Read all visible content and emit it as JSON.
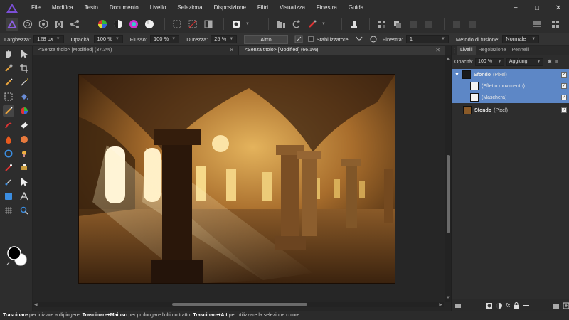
{
  "menubar": {
    "items": [
      "File",
      "Modifica",
      "Testo",
      "Documento",
      "Livello",
      "Seleziona",
      "Disposizione",
      "Filtri",
      "Visualizza",
      "Finestra",
      "Guida"
    ],
    "controls": [
      "−",
      "□",
      "✕"
    ]
  },
  "context": {
    "width_label": "Larghezza:",
    "width_value": "128 px",
    "opacity_label": "Opacità:",
    "opacity_value": "100 %",
    "flow_label": "Flusso:",
    "flow_value": "100 %",
    "hardness_label": "Durezza:",
    "hardness_value": "25 %",
    "more_label": "Altro",
    "stabilizer_label": "Stabilizzatore",
    "window_label": "Finestra:",
    "window_value": "1",
    "blend_label": "Metodo di fusione:",
    "blend_value": "Normale"
  },
  "tabs": [
    {
      "label": "<Senza titolo> [Modified] (37.3%)"
    },
    {
      "label": "<Senza titolo> [Modified] (66.1%)"
    }
  ],
  "panel": {
    "tabs": [
      "Livelli",
      "Regolazione",
      "Pennelli"
    ],
    "opacity_label": "Opacità:",
    "opacity_value": "100 %",
    "blend_value": "Aggiungi",
    "layers": [
      {
        "name": "Sfondo",
        "type": "(Pixel)",
        "selected": true
      },
      {
        "name": "(Effetto movimento)",
        "selected": true
      },
      {
        "name": "(Maschera)",
        "selected": true
      },
      {
        "name": "Sfondo",
        "type": "(Pixel)",
        "selected": false
      }
    ]
  },
  "status": {
    "a_bold": "Trascinare",
    "a_text": " per iniziare a dipingere. ",
    "b_bold": "Trascinare+Maiusc",
    "b_text": " per prolungare l'ultimo tratto. ",
    "c_bold": "Trascinare+Alt",
    "c_text": " per utilizzare la selezione colore."
  },
  "colors": {
    "accent": "#5d87c6",
    "logo": "#7b4fd6"
  }
}
